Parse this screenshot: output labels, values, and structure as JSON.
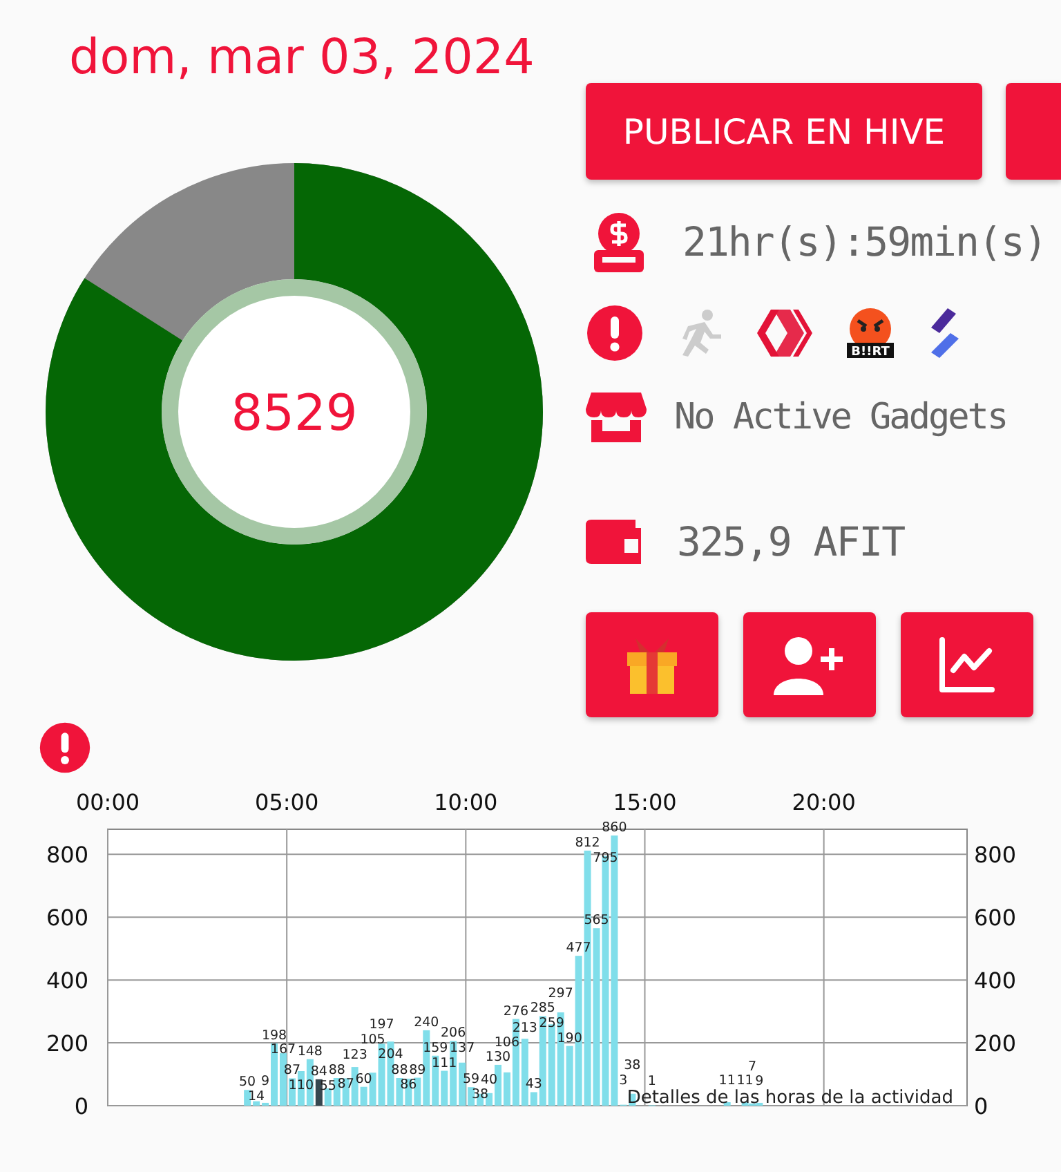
{
  "date": "dom, mar 03, 2024",
  "donut": {
    "value": "8529"
  },
  "publish_button": {
    "label": "PUBLICAR EN HIVE"
  },
  "timer": {
    "text": "21hr(s):59min(s)"
  },
  "badges": [
    {
      "kind": "runner"
    },
    {
      "kind": "hive"
    },
    {
      "kind": "face",
      "label": "B!!RT"
    },
    {
      "kind": "stripes"
    }
  ],
  "gadgets": {
    "text": "No Active Gadgets"
  },
  "wallet": {
    "text": "325,9 AFIT"
  },
  "action_buttons": [
    {
      "kind": "gift"
    },
    {
      "kind": "add-user"
    },
    {
      "kind": "chart"
    }
  ],
  "activity": {
    "chart_data": {
      "type": "bar",
      "grid": true,
      "data_labels": true,
      "xlim": [
        0,
        24
      ],
      "ylim": [
        0,
        880
      ],
      "xticks": [
        {
          "value": 0,
          "label": "00:00"
        },
        {
          "value": 5,
          "label": "05:00"
        },
        {
          "value": 10,
          "label": "10:00"
        },
        {
          "value": 15,
          "label": "15:00"
        },
        {
          "value": 20,
          "label": "20:00"
        }
      ],
      "yticks": [
        0,
        200,
        400,
        600,
        800
      ],
      "y2ticks": [
        0,
        200,
        400,
        600,
        800
      ],
      "y2lim": [
        0,
        880
      ],
      "x": [
        3.9,
        4.15,
        4.4,
        4.65,
        4.9,
        5.15,
        5.4,
        5.65,
        5.9,
        6.15,
        6.4,
        6.65,
        6.9,
        7.15,
        7.4,
        7.65,
        7.9,
        8.15,
        8.4,
        8.65,
        8.9,
        9.15,
        9.4,
        9.65,
        9.9,
        10.15,
        10.4,
        10.65,
        10.9,
        11.15,
        11.4,
        11.65,
        11.9,
        12.15,
        12.4,
        12.65,
        12.9,
        13.15,
        13.4,
        13.65,
        13.9,
        14.15,
        14.4,
        14.65,
        15.2,
        17.3,
        17.8,
        18.0,
        18.2
      ],
      "series": [
        {
          "color": "#80deea",
          "values": [
            50,
            14,
            9,
            198,
            167,
            87,
            110,
            148,
            null,
            55,
            88,
            87,
            123,
            60,
            105,
            197,
            204,
            88,
            86,
            89,
            240,
            159,
            111,
            206,
            137,
            59,
            38,
            40,
            130,
            106,
            276,
            213,
            43,
            285,
            259,
            297,
            190,
            477,
            812,
            565,
            795,
            860,
            3,
            38,
            1,
            11,
            11,
            7,
            9
          ]
        },
        {
          "color": "#37474f",
          "values": [
            null,
            null,
            null,
            null,
            null,
            null,
            null,
            null,
            84,
            null,
            null,
            null,
            null,
            null,
            null,
            null,
            null,
            null,
            null,
            null,
            null,
            null,
            null,
            null,
            null,
            null,
            null,
            null,
            null,
            null,
            null,
            null,
            null,
            null,
            null,
            null,
            null,
            null,
            null,
            null,
            null,
            null,
            null,
            null,
            null,
            null,
            null,
            null,
            null
          ]
        }
      ],
      "annotations": [
        "Detalles de las horas de la actividad"
      ]
    }
  }
}
